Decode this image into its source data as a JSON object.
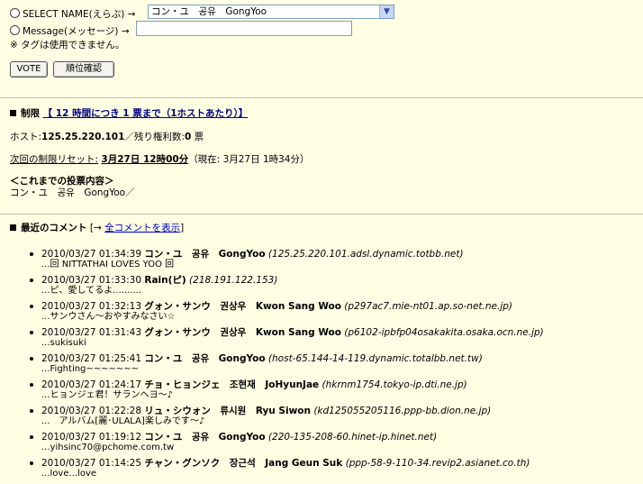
{
  "form": {
    "select_label": "SELECT NAME(えらぶ) →",
    "selected_name": "コン・ユ　공유　GongYoo",
    "message_label": "Message(メッセージ) →",
    "message_value": "",
    "tag_note": "※ タグは使用できません。",
    "vote_button": "VOTE",
    "rank_button": "順位確認"
  },
  "limit": {
    "title_prefix": "制限",
    "title_link": "【 12 時間につき 1 票まで（1ホストあたり）】",
    "host_label": "ホスト:",
    "host_value": "125.25.220.101",
    "remaining_label": "／残り権利数:",
    "remaining_value": "0",
    "remaining_unit": "票",
    "reset_label": "次回の制限リセット:",
    "reset_value": "3月27日 12時00分",
    "current_time": "（現在: 3月27日 1時34分）",
    "history_title": "＜これまでの投票内容＞",
    "history_value": "コン・ユ　공유　GongYoo／"
  },
  "recent": {
    "title": "最近のコメント",
    "link_prefix": "[→ ",
    "link_text": "全コメントを表示",
    "link_suffix": "]",
    "comments": [
      {
        "time": "2010/03/27 01:34:39",
        "name": "コン・ユ　공유　GongYoo",
        "host": "(125.25.220.101.adsl.dynamic.totbb.net)",
        "text": "...回 NITTATHAI LOVES YOO 回"
      },
      {
        "time": "2010/03/27 01:33:30",
        "name": "Rain(ピ)",
        "host": "(218.191.122.153)",
        "text": "...ピ、愛してるよ.........."
      },
      {
        "time": "2010/03/27 01:32:13",
        "name": "グォン・サンウ　권상우　Kwon Sang Woo",
        "host": "(p297ac7.mie-nt01.ap.so-net.ne.jp)",
        "text": "...サンウさん～おやすみなさい☆"
      },
      {
        "time": "2010/03/27 01:31:43",
        "name": "グォン・サンウ　권상우　Kwon Sang Woo",
        "host": "(p6102-ipbfp04osakakita.osaka.ocn.ne.jp)",
        "text": "...sukisuki"
      },
      {
        "time": "2010/03/27 01:25:41",
        "name": "コン・ユ　공유　GongYoo",
        "host": "(host-65.144-14-119.dynamic.totalbb.net.tw)",
        "text": "...Fighting~~~~~~~"
      },
      {
        "time": "2010/03/27 01:24:17",
        "name": "チョ・ヒョンジェ　조현재　JoHyunJae",
        "host": "(hkrnm1754.tokyo-ip.dti.ne.jp)",
        "text": "...ヒョンジェ君！サランヘヨ～♪"
      },
      {
        "time": "2010/03/27 01:22:28",
        "name": "リュ・シウォン　류시원　Ryu Siwon",
        "host": "(kd125055205116.ppp-bb.dion.ne.jp)",
        "text": "...　アルバム[麗･ULALA]楽しみです～♪"
      },
      {
        "time": "2010/03/27 01:19:12",
        "name": "コン・ユ　공유　GongYoo",
        "host": "(220-135-208-60.hinet-ip.hinet.net)",
        "text": "...yihsinc70@pchome.com.tw"
      },
      {
        "time": "2010/03/27 01:14:25",
        "name": "チャン・グンソク　장근석　Jang Geun Suk",
        "host": "(ppp-58-9-110-34.revip2.asianet.co.th)",
        "text": "...love...love"
      }
    ]
  }
}
